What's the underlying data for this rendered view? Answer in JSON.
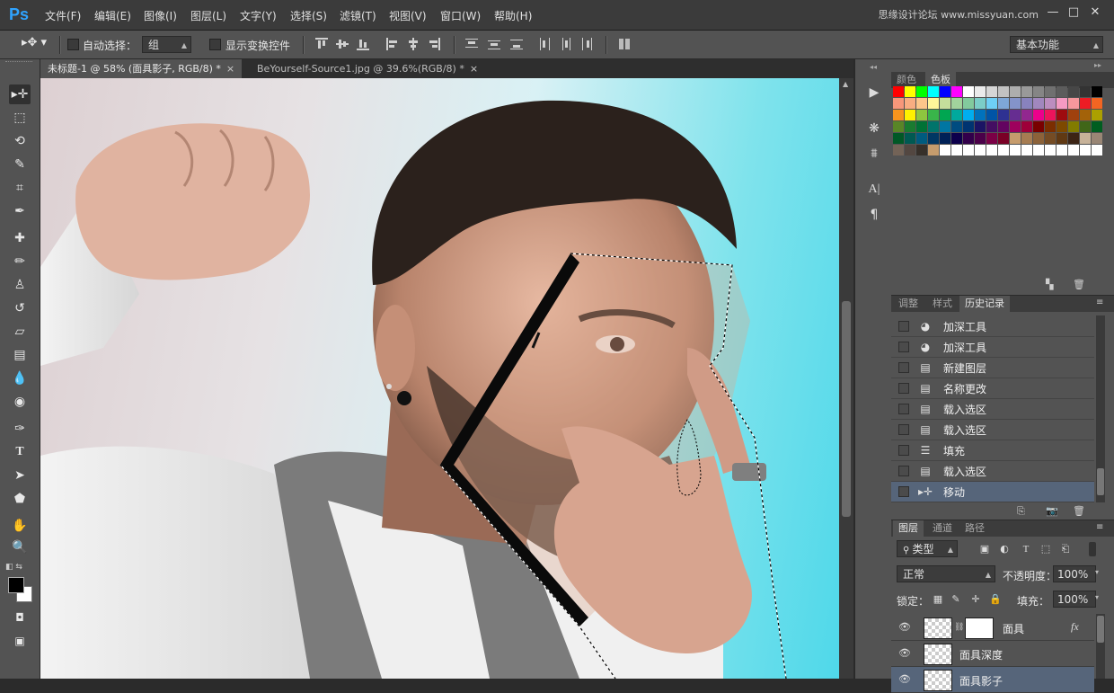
{
  "app": {
    "logo": "Ps"
  },
  "menu": [
    "文件(F)",
    "编辑(E)",
    "图像(I)",
    "图层(L)",
    "文字(Y)",
    "选择(S)",
    "滤镜(T)",
    "视图(V)",
    "窗口(W)",
    "帮助(H)"
  ],
  "watermark": "思缘设计论坛 www.missyuan.com",
  "window_controls": [
    "—",
    "□",
    "✕"
  ],
  "options": {
    "auto_select_label": "自动选择：",
    "auto_select_value": "组",
    "show_transform_label": "显示变换控件",
    "workspace": "基本功能"
  },
  "tabs": [
    {
      "label": "未标题-1 @ 58% (面具影子, RGB/8) *",
      "close": "×"
    },
    {
      "label": "BeYourself-Source1.jpg @ 39.6%(RGB/8) *",
      "close": "×"
    }
  ],
  "swatch_panel": {
    "tabs": [
      "颜色",
      "色板"
    ],
    "active": 1
  },
  "swatch_colors": [
    "#ff0000",
    "#ffff00",
    "#00ff00",
    "#00ffff",
    "#0000ff",
    "#ff00ff",
    "#ffffff",
    "#ebebeb",
    "#d6d6d6",
    "#c2c2c2",
    "#adadad",
    "#999999",
    "#858585",
    "#707070",
    "#5c5c5c",
    "#474747",
    "#333333",
    "#000000",
    "#f7977a",
    "#f9ad81",
    "#fdc68a",
    "#fff79a",
    "#c4df9b",
    "#a2d39c",
    "#82ca9d",
    "#7bcdc8",
    "#6ecff6",
    "#7ea7d8",
    "#8493ca",
    "#8882be",
    "#a187be",
    "#bc8dbf",
    "#f49ac2",
    "#f6989d",
    "#ed1c24",
    "#f26522",
    "#f7941d",
    "#fff200",
    "#8dc63f",
    "#39b54a",
    "#00a651",
    "#00a99d",
    "#00aeef",
    "#0072bc",
    "#0054a6",
    "#2e3192",
    "#662d91",
    "#92278f",
    "#ec008c",
    "#ed145b",
    "#9e0b0f",
    "#a0410d",
    "#a36209",
    "#aba000",
    "#598527",
    "#1a7b30",
    "#007236",
    "#00746b",
    "#0076a3",
    "#004b80",
    "#003471",
    "#1b1464",
    "#440e62",
    "#630460",
    "#9e005d",
    "#9e0039",
    "#790000",
    "#7b2e00",
    "#7d4900",
    "#827b00",
    "#406618",
    "#005e20",
    "#005826",
    "#005952",
    "#005b7f",
    "#003663",
    "#002157",
    "#0d004c",
    "#32004b",
    "#4b0049",
    "#7b0046",
    "#7a0026",
    "#c69c6d",
    "#a67c52",
    "#8c6239",
    "#754c24",
    "#603913",
    "#3c2415",
    "#c7b299",
    "#998675",
    "#736357",
    "#534741",
    "#37302a",
    "#c69c6d",
    "#ffffff",
    "#ffffff",
    "#ffffff",
    "#ffffff",
    "#ffffff",
    "#ffffff",
    "#ffffff",
    "#ffffff",
    "#ffffff",
    "#ffffff",
    "#ffffff",
    "#ffffff",
    "#ffffff",
    "#ffffff"
  ],
  "history_panel": {
    "tabs": [
      "调整",
      "样式",
      "历史记录"
    ],
    "active": 2,
    "items": [
      {
        "icon": "burn-icon",
        "label": "加深工具"
      },
      {
        "icon": "burn-icon",
        "label": "加深工具"
      },
      {
        "icon": "doc-icon",
        "label": "新建图层"
      },
      {
        "icon": "doc-icon",
        "label": "名称更改"
      },
      {
        "icon": "doc-icon",
        "label": "载入选区"
      },
      {
        "icon": "doc-icon",
        "label": "载入选区"
      },
      {
        "icon": "fill-icon",
        "label": "填充"
      },
      {
        "icon": "doc-icon",
        "label": "载入选区"
      },
      {
        "icon": "move-icon",
        "label": "移动",
        "selected": true
      }
    ]
  },
  "layers_panel": {
    "tabs": [
      "图层",
      "通道",
      "路径"
    ],
    "active": 0,
    "filter": "类型",
    "blend_mode": "正常",
    "opacity_label": "不透明度：",
    "opacity": "100%",
    "lock_label": "锁定：",
    "fill_label": "填充：",
    "fill": "100%",
    "layers": [
      {
        "name": "面具",
        "fx": "fx",
        "has_mask": true
      },
      {
        "name": "面具深度"
      },
      {
        "name": "面具影子",
        "selected": true
      }
    ]
  }
}
